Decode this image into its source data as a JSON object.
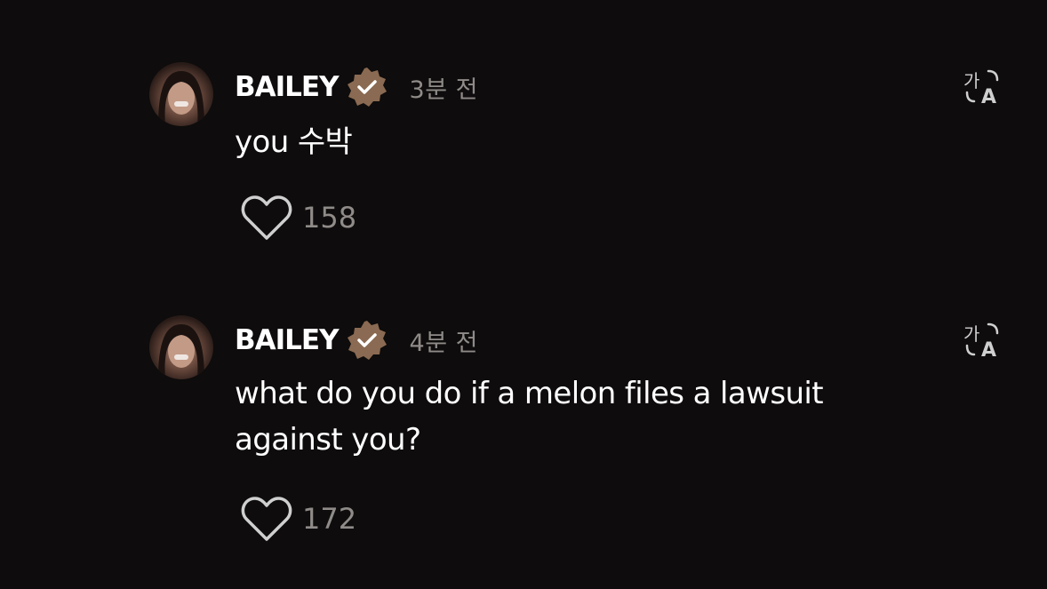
{
  "comments": [
    {
      "author": "BAILEY",
      "verified": true,
      "time": "3분 전",
      "text": "you 수박",
      "likes": "158",
      "icons": {
        "avatar": "profile-photo",
        "badge": "verified-badge-icon",
        "translate": "translate-icon",
        "like": "heart-outline-icon"
      }
    },
    {
      "author": "BAILEY",
      "verified": true,
      "time": "4분 전",
      "text": "what do you do if a melon files a lawsuit against you?",
      "likes": "172",
      "icons": {
        "avatar": "profile-photo",
        "badge": "verified-badge-icon",
        "translate": "translate-icon",
        "like": "heart-outline-icon"
      }
    }
  ],
  "colors": {
    "background": "#0e0c0c",
    "text_primary": "#ffffff",
    "text_secondary": "#8f8b89",
    "verified_badge": "#8a6a52"
  }
}
